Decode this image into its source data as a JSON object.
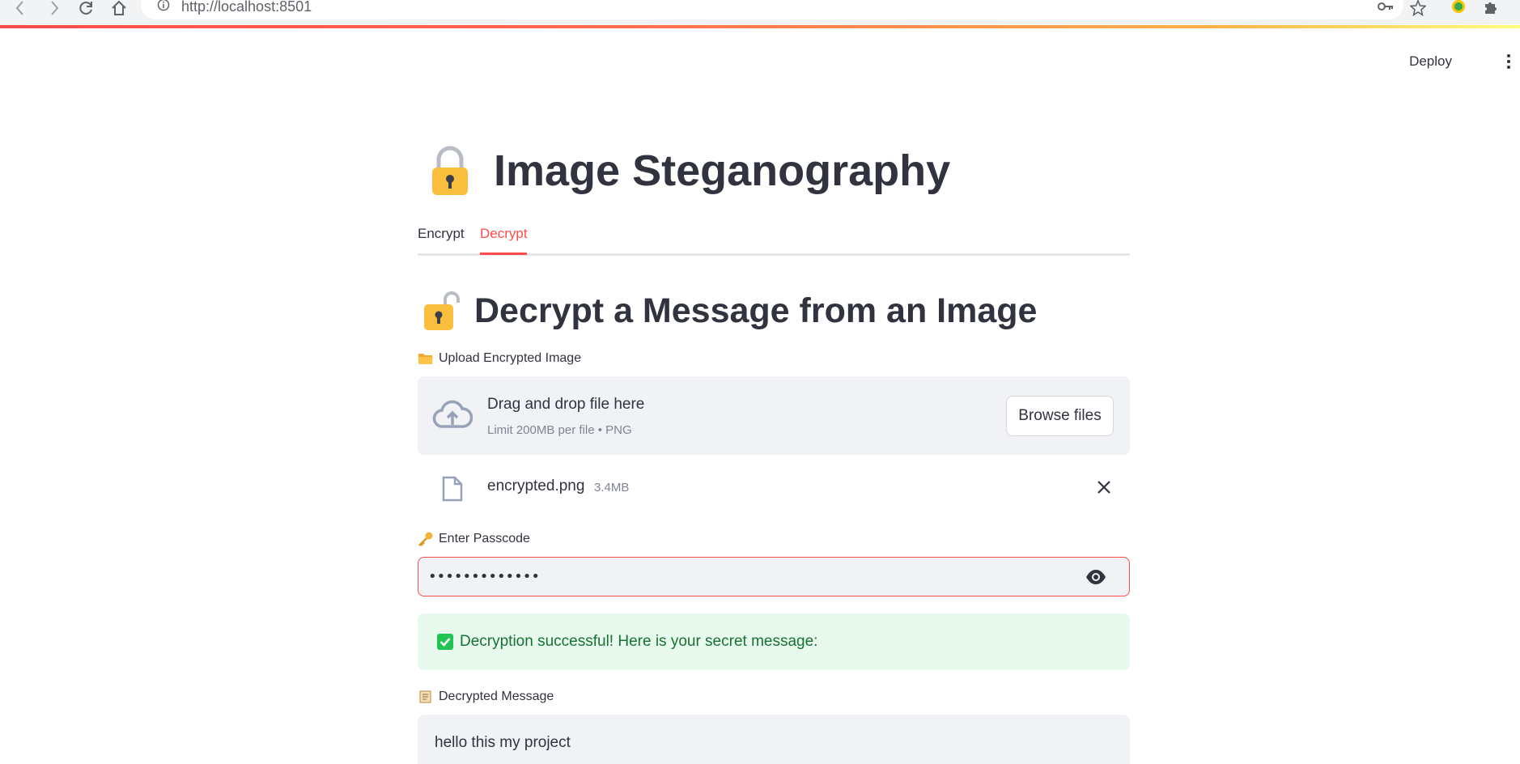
{
  "browser": {
    "url": "http://localhost:8501"
  },
  "header": {
    "deploy_label": "Deploy"
  },
  "page": {
    "title": "Image Steganography"
  },
  "tabs": [
    {
      "label": "Encrypt",
      "active": false
    },
    {
      "label": "Decrypt",
      "active": true
    }
  ],
  "decrypt": {
    "heading": "Decrypt a Message from an Image",
    "upload_label": "Upload Encrypted Image",
    "dropzone_title": "Drag and drop file here",
    "dropzone_limit": "Limit 200MB per file • PNG",
    "browse_label": "Browse files",
    "file": {
      "name": "encrypted.png",
      "size": "3.4MB"
    },
    "passcode_label": "Enter Passcode",
    "passcode_value": "•••••••••••••",
    "success_message": "Decryption successful! Here is your secret message:",
    "message_label": "Decrypted Message",
    "message_value": "hello this my project"
  },
  "icons": {
    "title": "lock-icon",
    "heading": "unlocked-lock-icon",
    "upload": "folder-icon",
    "passcode": "key-icon",
    "message": "scroll-icon",
    "success": "check-box-icon"
  },
  "colors": {
    "accent": "#ff4b4b",
    "success_bg": "#e8f9ee",
    "success_text": "#177233",
    "input_bg": "#f0f2f6"
  }
}
